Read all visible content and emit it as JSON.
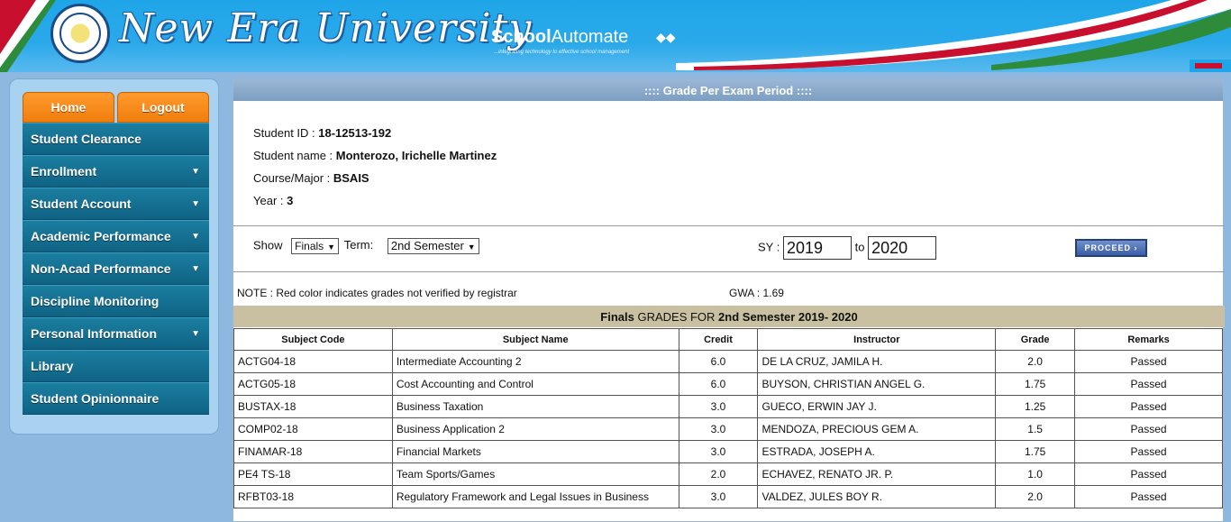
{
  "header": {
    "brand": "New Era University",
    "product_school": "School",
    "product_automate": "Automate",
    "tagline": "...integrating technology to effective school management",
    "logo_text": "NEW ERA UNIVERSITY"
  },
  "sidebar": {
    "top_buttons": [
      "Home",
      "Logout"
    ],
    "items": [
      {
        "label": "Student Clearance",
        "has_arrow": false
      },
      {
        "label": "Enrollment",
        "has_arrow": true
      },
      {
        "label": "Student Account",
        "has_arrow": true
      },
      {
        "label": "Academic Performance",
        "has_arrow": true
      },
      {
        "label": "Non-Acad Performance",
        "has_arrow": true
      },
      {
        "label": "Discipline Monitoring",
        "has_arrow": false
      },
      {
        "label": "Personal Information",
        "has_arrow": true
      },
      {
        "label": "Library",
        "has_arrow": false
      },
      {
        "label": "Student Opinionnaire",
        "has_arrow": false
      }
    ],
    "arrow_glyph": "▼"
  },
  "main": {
    "title": ":::: Grade Per Exam Period ::::",
    "student": {
      "id_label": "Student ID : ",
      "id_value": "18-12513-192",
      "name_label": "Student name : ",
      "name_value": "Monterozo, Irichelle Martinez",
      "course_label": "Course/Major : ",
      "course_value": "BSAIS",
      "year_label": "Year : ",
      "year_value": "3"
    },
    "filters": {
      "show_label": "Show",
      "show_value": "Finals",
      "term_label": "Term:",
      "term_value": "2nd Semester",
      "sy_label": "SY :",
      "sy_from": "2019",
      "to_label": "to",
      "sy_to": "2020",
      "proceed_label": "PROCEED ›"
    },
    "note": "NOTE : Red color indicates grades not verified by registrar",
    "gwa": "GWA : 1.69",
    "band": {
      "part1": "Finals",
      "part2": " GRADES FOR ",
      "part3": "2nd Semester 2019- 2020"
    },
    "table": {
      "headers": [
        "Subject Code",
        "Subject Name",
        "Credit",
        "Instructor",
        "Grade",
        "Remarks"
      ],
      "rows": [
        [
          "ACTG04-18",
          "Intermediate Accounting 2",
          "6.0",
          "DE LA CRUZ, JAMILA H.",
          "2.0",
          "Passed"
        ],
        [
          "ACTG05-18",
          "Cost Accounting and Control",
          "6.0",
          "BUYSON, CHRISTIAN ANGEL G.",
          "1.75",
          "Passed"
        ],
        [
          "BUSTAX-18",
          "Business Taxation",
          "3.0",
          "GUECO, ERWIN JAY J.",
          "1.25",
          "Passed"
        ],
        [
          "COMP02-18",
          "Business Application 2",
          "3.0",
          "MENDOZA, PRECIOUS GEM A.",
          "1.5",
          "Passed"
        ],
        [
          "FINAMAR-18",
          "Financial Markets",
          "3.0",
          "ESTRADA, JOSEPH A.",
          "1.75",
          "Passed"
        ],
        [
          "PE4 TS-18",
          "Team Sports/Games",
          "2.0",
          "ECHAVEZ, RENATO JR. P.",
          "1.0",
          "Passed"
        ],
        [
          "RFBT03-18",
          "Regulatory Framework and Legal Issues in Business",
          "3.0",
          "VALDEZ, JULES BOY R.",
          "2.0",
          "Passed"
        ]
      ]
    }
  },
  "colors": {
    "header_blue": "#1fa6e8",
    "menu_teal": "#0f6384",
    "orange": "#f07e0c",
    "band": "#c8c0a0"
  }
}
